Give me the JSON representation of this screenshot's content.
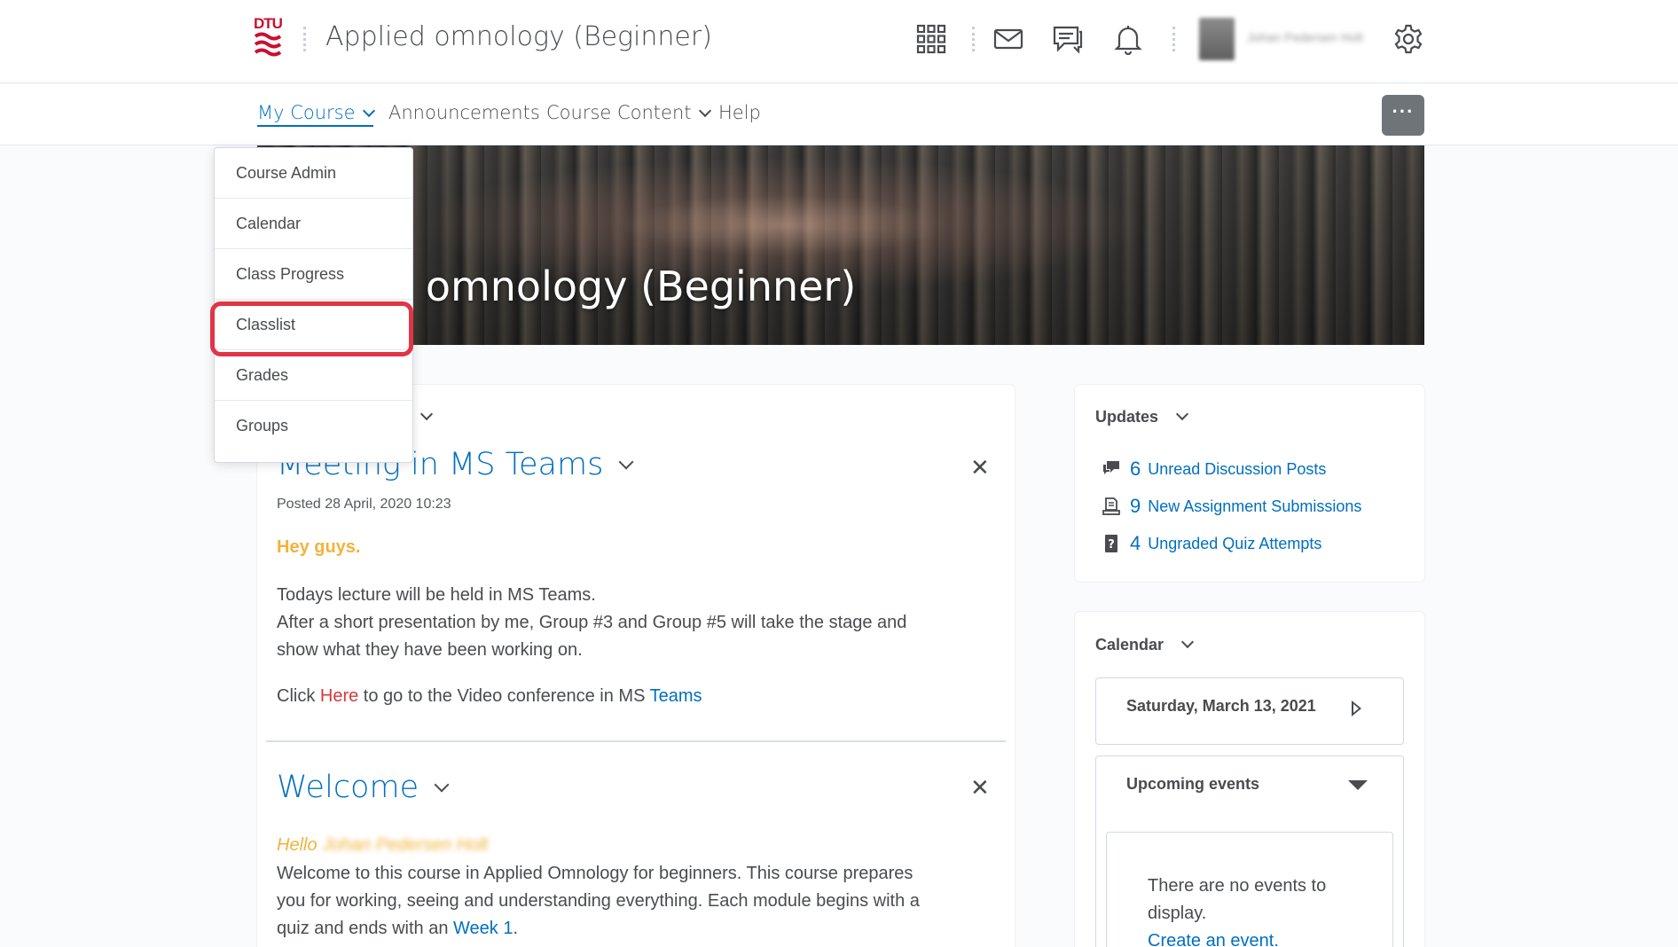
{
  "header": {
    "logo_text": "DTU",
    "course_title": "Applied omnology (Beginner)",
    "icons": [
      "apps-grid-icon",
      "mail-icon",
      "chat-icon",
      "bell-icon",
      "gear-icon"
    ],
    "user_name": "Johan Pedersen Holt"
  },
  "nav": {
    "items": [
      {
        "label": "My Course",
        "has_dropdown": true,
        "active": true
      },
      {
        "label": "Announcements",
        "has_dropdown": false
      },
      {
        "label": "Course Content",
        "has_dropdown": true
      },
      {
        "label": "Help",
        "has_dropdown": false
      }
    ],
    "more_label": "···"
  },
  "banner": {
    "title_visible": "d omnology (Beginner)"
  },
  "dropdown": {
    "items": [
      "Course Admin",
      "Calendar",
      "Class Progress",
      "Classlist",
      "Grades",
      "Groups"
    ],
    "highlighted": "Classlist"
  },
  "announcements": {
    "first": {
      "title": "Meeting in MS Teams",
      "posted": "Posted 28 April, 2020 10:23",
      "greeting": "Hey guys.",
      "line1": "Todays lecture will be held in MS Teams.",
      "line2": "After a short presentation by me, Group #3 and Group #5 will take the stage and",
      "line3": "show what they have been working on.",
      "click_prefix": "Click ",
      "click_link": "Here",
      "click_middle": " to go to the Video conference in MS ",
      "click_link2": "Teams"
    },
    "second": {
      "title": "Welcome",
      "greeting": "Hello",
      "greeting_name": "Johan Pedersen Holt",
      "line1": "Welcome to this course in Applied Omnology for beginners. This course prepares",
      "line2": "you for working, seeing and understanding everything. Each module begins with a",
      "line3_prefix": "quiz and ends with an ",
      "line3_link": "Week 1",
      "line3_suffix": "."
    }
  },
  "updates": {
    "title": "Updates",
    "rows": [
      {
        "count": "6",
        "label": "Unread Discussion Posts",
        "icon": "discussion-icon"
      },
      {
        "count": "9",
        "label": "New Assignment Submissions",
        "icon": "assignment-icon"
      },
      {
        "count": "4",
        "label": "Ungraded Quiz Attempts",
        "icon": "quiz-icon"
      }
    ]
  },
  "calendar": {
    "title": "Calendar",
    "date": "Saturday, March 13, 2021",
    "upcoming_label": "Upcoming events",
    "no_events_line1": "There are no events to",
    "no_events_line2": "display.",
    "create_link": "Create an event."
  },
  "colors": {
    "link_blue": "#006fbf",
    "highlight_red": "#e03546",
    "greeting_yellow": "#f2b33b",
    "logo_red": "#c8102e"
  }
}
